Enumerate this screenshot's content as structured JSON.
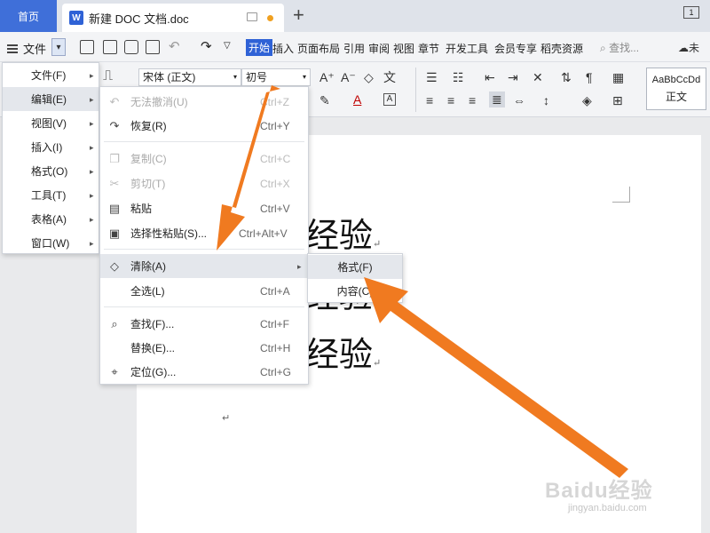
{
  "tabbar": {
    "home_label": "首页",
    "doc_icon_letter": "W",
    "doc_title": "新建 DOC 文档.doc",
    "new_tab": "+",
    "window_badge": "1"
  },
  "ribbon": {
    "file_label": "文件",
    "tabs": [
      "开始",
      "插入",
      "页面布局",
      "引用",
      "审阅",
      "视图",
      "章节",
      "开发工具",
      "会员专享",
      "稻壳资源"
    ],
    "search_placeholder": "查找...",
    "cloud_label": "未"
  },
  "toolbar": {
    "font_name": "宋体 (正文)",
    "font_size": "初号",
    "style_sample": "AaBbCcDd",
    "style_name": "正文"
  },
  "document": {
    "lines": [
      "经验",
      "经验",
      "经验"
    ],
    "para_mark": "↵"
  },
  "main_menu": {
    "items": [
      {
        "label": "文件(F)"
      },
      {
        "label": "编辑(E)"
      },
      {
        "label": "视图(V)"
      },
      {
        "label": "插入(I)"
      },
      {
        "label": "格式(O)"
      },
      {
        "label": "工具(T)"
      },
      {
        "label": "表格(A)"
      },
      {
        "label": "窗口(W)"
      }
    ]
  },
  "edit_menu": {
    "items": [
      {
        "label": "无法撤消(U)",
        "shortcut": "Ctrl+Z",
        "icon": "undo-icon"
      },
      {
        "label": "恢复(R)",
        "shortcut": "Ctrl+Y",
        "icon": "redo-icon"
      },
      {
        "label": "复制(C)",
        "shortcut": "Ctrl+C",
        "icon": "copy-icon"
      },
      {
        "label": "剪切(T)",
        "shortcut": "Ctrl+X",
        "icon": "scissors-icon"
      },
      {
        "label": "粘贴",
        "shortcut": "Ctrl+V",
        "icon": "paste-icon"
      },
      {
        "label": "选择性粘贴(S)...",
        "shortcut": "Ctrl+Alt+V",
        "icon": "paste-special-icon"
      },
      {
        "label": "清除(A)",
        "shortcut": "",
        "icon": "eraser-icon"
      },
      {
        "label": "全选(L)",
        "shortcut": "Ctrl+A",
        "icon": ""
      },
      {
        "label": "查找(F)...",
        "shortcut": "Ctrl+F",
        "icon": "search-icon"
      },
      {
        "label": "替换(E)...",
        "shortcut": "Ctrl+H",
        "icon": ""
      },
      {
        "label": "定位(G)...",
        "shortcut": "Ctrl+G",
        "icon": "locate-icon"
      }
    ]
  },
  "clear_submenu": {
    "items": [
      {
        "label": "格式(F)"
      },
      {
        "label": "内容(C)"
      }
    ]
  },
  "annotation": {
    "arrow_color": "#f07a20"
  },
  "watermark": {
    "brand": "Baidu经验",
    "url": "jingyan.baidu.com"
  }
}
